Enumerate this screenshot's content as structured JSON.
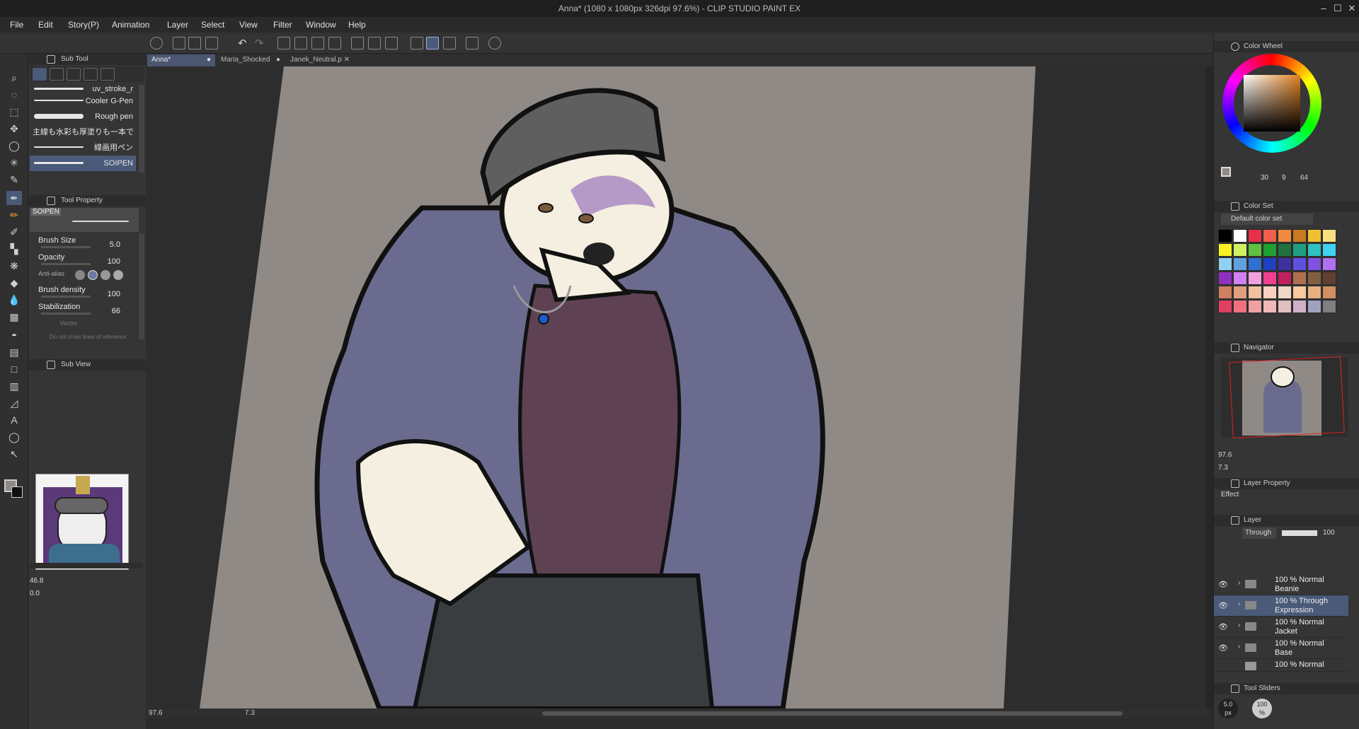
{
  "window": {
    "title": "Anna* (1080 x 1080px 326dpi 97.6%) - CLIP STUDIO PAINT EX",
    "min": "–",
    "max": "☐",
    "close": "✕"
  },
  "menu": [
    "File",
    "Edit",
    "Story(P)",
    "Animation",
    "Layer",
    "Select",
    "View",
    "Filter",
    "Window",
    "Help"
  ],
  "tabs": [
    {
      "label": "Anna*"
    },
    {
      "label": "Maria_Shocked"
    },
    {
      "label": "Janek_Neutral.p"
    }
  ],
  "sub_tool": {
    "title": "Sub Tool",
    "brushes": [
      "uv_stroke_r",
      "Cooler G-Pen",
      "Rough pen",
      "主線も水彩も厚塗りも一本で",
      "線画用ペン",
      "SOIPEN"
    ]
  },
  "tool_property": {
    "title": "Tool Property",
    "preset": "SOIPEN",
    "rows": [
      {
        "label": "Brush Size",
        "value": "5.0"
      },
      {
        "label": "Opacity",
        "value": "100"
      },
      {
        "label": "Anti-alias",
        "value": ""
      },
      {
        "label": "Brush density",
        "value": "100"
      },
      {
        "label": "Stabilization",
        "value": "66"
      }
    ],
    "vector": "Vector",
    "do_not_cross": "Do not cross lines of reference"
  },
  "sub_view": {
    "title": "Sub View",
    "zoom": "46.8",
    "angle": "0.0"
  },
  "canvas_footer": {
    "zoom": "97.6",
    "angle": "7.3"
  },
  "color_wheel": {
    "title": "Color Wheel",
    "h": "30",
    "s": "9",
    "v": "64"
  },
  "color_set": {
    "title": "Color Set",
    "selected": "Default color set",
    "colors": [
      "#000000",
      "#ffffff",
      "#e8304a",
      "#f0604a",
      "#f08a40",
      "#c87a20",
      "#f0c030",
      "#f8e080",
      "#f8f020",
      "#d0f060",
      "#60c040",
      "#20a030",
      "#207040",
      "#20a080",
      "#30c0c0",
      "#40d0f0",
      "#90d0f0",
      "#60a0e0",
      "#3070d0",
      "#2040c0",
      "#4030a0",
      "#6050e0",
      "#8050e0",
      "#b070f0",
      "#9030c0",
      "#d080f0",
      "#f0a0e0",
      "#f04090",
      "#c02060",
      "#b07050",
      "#806040",
      "#604030",
      "#d08060",
      "#e0a080",
      "#f0c0a0",
      "#f8d0c0",
      "#f0d8c8",
      "#f8c8a0",
      "#e8b080",
      "#d09060",
      "#e04060",
      "#f07080",
      "#f0a0a0",
      "#f0b8b8",
      "#e0c0c0",
      "#d0b0c8",
      "#a0a0c0",
      "#808080"
    ]
  },
  "navigator": {
    "title": "Navigator",
    "zoom": "97.6",
    "angle": "7.3"
  },
  "layer_property": {
    "title": "Layer Property",
    "effect": "Effect"
  },
  "layer_panel": {
    "title": "Layer",
    "blend": "Through",
    "opacity": "100",
    "layers": [
      {
        "mode": "100 % Normal",
        "name": "Beanie"
      },
      {
        "mode": "100 % Through",
        "name": "Expression"
      },
      {
        "mode": "100 % Normal",
        "name": "Jacket"
      },
      {
        "mode": "100 % Normal",
        "name": "Base"
      },
      {
        "mode": "100 % Normal",
        "name": ""
      }
    ]
  },
  "tool_sliders": {
    "title": "Tool Sliders",
    "size": "5.0",
    "size_unit": "px",
    "opacity": "100",
    "opacity_unit": "%"
  },
  "colors": {
    "accent": "#4a5a78",
    "canvas_paper": "#8f8a86",
    "jacket": "#6b6b8f",
    "shirt": "#5e4253"
  }
}
